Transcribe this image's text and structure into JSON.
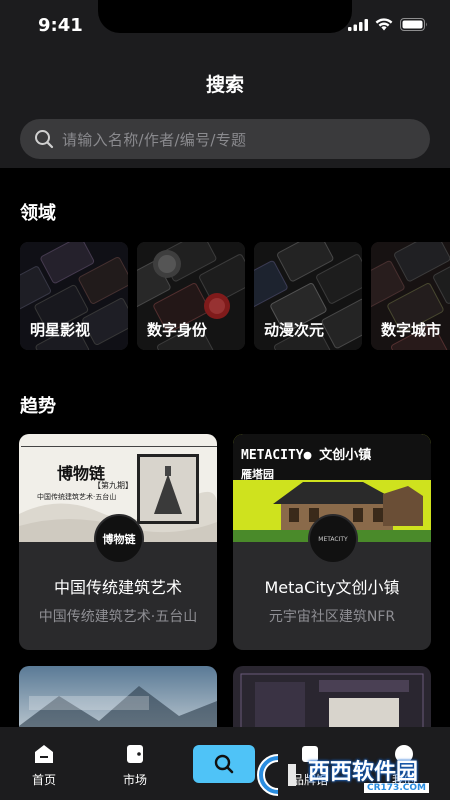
{
  "status": {
    "time": "9:41"
  },
  "header": {
    "title": "搜索"
  },
  "search": {
    "placeholder": "请输入名称/作者/编号/专题"
  },
  "domain": {
    "title": "领域",
    "items": [
      {
        "label": "明星影视"
      },
      {
        "label": "数字身份"
      },
      {
        "label": "动漫次元"
      },
      {
        "label": "数字城市"
      }
    ]
  },
  "trend": {
    "title": "趋势",
    "cards": [
      {
        "title": "中国传统建筑艺术",
        "subtitle": "中国传统建筑艺术·五台山",
        "image_text": "博物链",
        "image_caption": "中国传统建筑艺术·五台山",
        "issue": "【第九期】",
        "avatar_text": "博物链"
      },
      {
        "title": "MetaCity文创小镇",
        "subtitle": "元宇宙社区建筑NFR",
        "image_text": "METACITY● 文创小镇",
        "image_caption": "雁塔园",
        "avatar_text": "METACITY"
      }
    ]
  },
  "tabs": [
    {
      "label": "首页",
      "icon": "home-icon"
    },
    {
      "label": "市场",
      "icon": "market-icon"
    },
    {
      "label": "",
      "icon": "search-icon"
    },
    {
      "label": "品牌馆",
      "icon": "brand-icon"
    },
    {
      "label": "我的",
      "icon": "profile-icon"
    }
  ],
  "watermark": {
    "text": "西西软件园",
    "sub": "CR173.COM"
  },
  "colors": {
    "accent": "#4fc3f7",
    "background": "#000000",
    "surface": "#1c1c1e",
    "card": "#2a2a2c"
  }
}
